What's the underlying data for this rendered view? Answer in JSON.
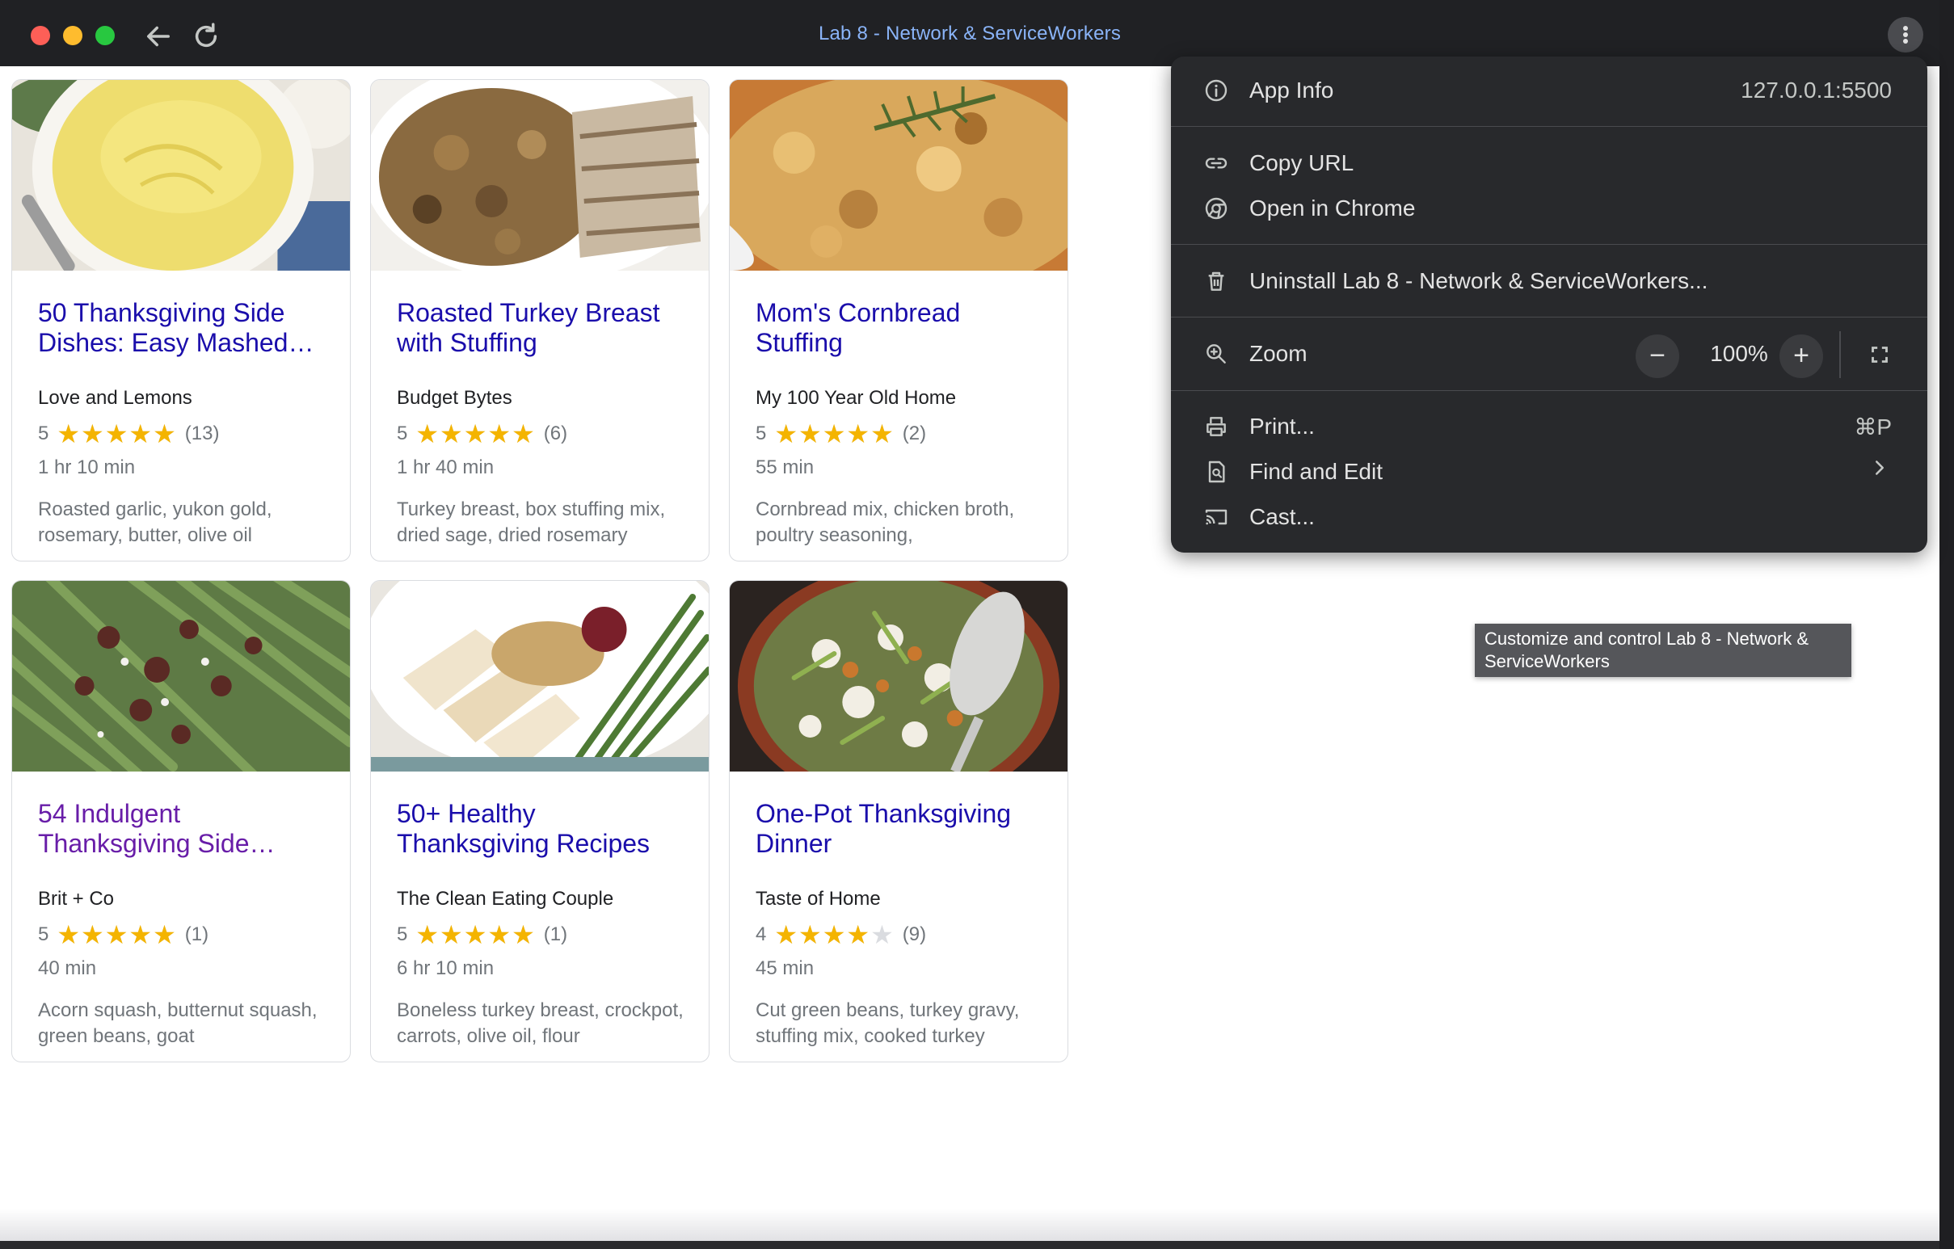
{
  "window": {
    "title": "Lab 8 - Network & ServiceWorkers"
  },
  "recipes": [
    {
      "title": "50 Thanksgiving Side Dishes: Easy Mashed…",
      "source": "Love and Lemons",
      "rating": 5,
      "rating_count": "(13)",
      "time": "1 hr 10 min",
      "ingredients": "Roasted garlic, yukon gold, rosemary, butter, olive oil",
      "visited": false
    },
    {
      "title": "Roasted Turkey Breast with Stuffing",
      "source": "Budget Bytes",
      "rating": 5,
      "rating_count": "(6)",
      "time": "1 hr 40 min",
      "ingredients": "Turkey breast, box stuffing mix, dried sage, dried rosemary",
      "visited": false
    },
    {
      "title": "Mom's Cornbread Stuffing",
      "source": "My 100 Year Old Home",
      "rating": 5,
      "rating_count": "(2)",
      "time": "55 min",
      "ingredients": "Cornbread mix, chicken broth, poultry seasoning,",
      "visited": false
    },
    {
      "title": "54 Indulgent Thanksgiving Side…",
      "source": "Brit + Co",
      "rating": 5,
      "rating_count": "(1)",
      "time": "40 min",
      "ingredients": "Acorn squash, butternut squash, green beans, goat",
      "visited": true
    },
    {
      "title": "50+ Healthy Thanksgiving Recipes",
      "source": "The Clean Eating Couple",
      "rating": 5,
      "rating_count": "(1)",
      "time": "6 hr 10 min",
      "ingredients": "Boneless turkey breast, crockpot, carrots, olive oil, flour",
      "visited": false
    },
    {
      "title": "One-Pot Thanksgiving Dinner",
      "source": "Taste of Home",
      "rating": 4,
      "rating_count": "(9)",
      "time": "45 min",
      "ingredients": "Cut green beans, turkey gravy, stuffing mix, cooked turkey",
      "visited": false
    }
  ],
  "menu": {
    "app_info": {
      "label": "App Info",
      "value": "127.0.0.1:5500"
    },
    "copy_url": "Copy URL",
    "open_in_chrome": "Open in Chrome",
    "uninstall": "Uninstall Lab 8 - Network & ServiceWorkers...",
    "zoom": {
      "label": "Zoom",
      "minus": "−",
      "value": "100%",
      "plus": "+"
    },
    "print": {
      "label": "Print...",
      "shortcut": "⌘P"
    },
    "find_and_edit": "Find and Edit",
    "cast": "Cast..."
  },
  "tooltip": "Customize and control Lab 8 - Network & ServiceWorkers",
  "icons": [
    "back-arrow-icon",
    "reload-icon",
    "more-vert-icon",
    "info-icon",
    "link-icon",
    "chrome-icon",
    "trash-icon",
    "zoom-icon",
    "fullscreen-icon",
    "print-icon",
    "find-page-icon",
    "cast-icon",
    "chevron-right-icon",
    "star-icon"
  ],
  "colors": {
    "link": "#1a0dab",
    "visited_link": "#681da8",
    "star": "#f4b400",
    "menu_bg": "#28292c",
    "title_text": "#8ab4f8"
  }
}
